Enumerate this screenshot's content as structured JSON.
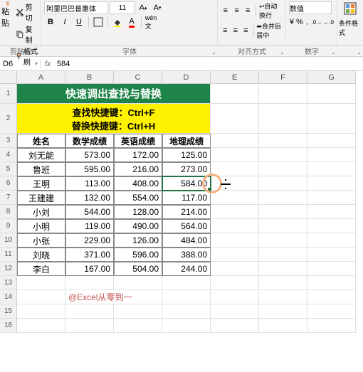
{
  "ribbon": {
    "clipboard": {
      "paste": "粘贴",
      "cut": "剪切",
      "copy": "复制",
      "format_painter": "格式刷",
      "group": "剪贴板"
    },
    "font": {
      "name": "阿里巴巴普惠体",
      "size": "11",
      "group": "字体",
      "bold": "B",
      "italic": "I",
      "underline": "U"
    },
    "align": {
      "wrap": "自动换行",
      "merge": "合并后居中",
      "group": "对齐方式"
    },
    "number": {
      "format": "数值",
      "group": "数字"
    },
    "styles": {
      "conditional": "条件格式",
      "group": ""
    }
  },
  "namebox": "D6",
  "formula": "584",
  "columns": [
    "A",
    "B",
    "C",
    "D",
    "E",
    "F",
    "G"
  ],
  "row_heights": {
    "r1": 28,
    "r2": 42,
    "default": 20
  },
  "title": "快速调出查找与替换",
  "shortcut_find": "查找快捷键：Ctrl+F",
  "shortcut_replace": "替换快捷键：Ctrl+H",
  "headers": [
    "姓名",
    "数学成绩",
    "英语成绩",
    "地理成绩"
  ],
  "rows": [
    {
      "name": "刘无能",
      "math": "573.00",
      "eng": "172.00",
      "geo": "125.00"
    },
    {
      "name": "鲁班",
      "math": "595.00",
      "eng": "216.00",
      "geo": "273.00"
    },
    {
      "name": "王明",
      "math": "113.00",
      "eng": "408.00",
      "geo": "584.00"
    },
    {
      "name": "王建建",
      "math": "132.00",
      "eng": "554.00",
      "geo": "117.00"
    },
    {
      "name": "小刘",
      "math": "544.00",
      "eng": "128.00",
      "geo": "214.00"
    },
    {
      "name": "小明",
      "math": "119.00",
      "eng": "490.00",
      "geo": "564.00"
    },
    {
      "name": "小张",
      "math": "229.00",
      "eng": "126.00",
      "geo": "484.00"
    },
    {
      "name": "刘晓",
      "math": "371.00",
      "eng": "596.00",
      "geo": "388.00"
    },
    {
      "name": "李白",
      "math": "167.00",
      "eng": "504.00",
      "geo": "244.00"
    }
  ],
  "watermark": "@Excel从零到一",
  "active_cell": "D6"
}
